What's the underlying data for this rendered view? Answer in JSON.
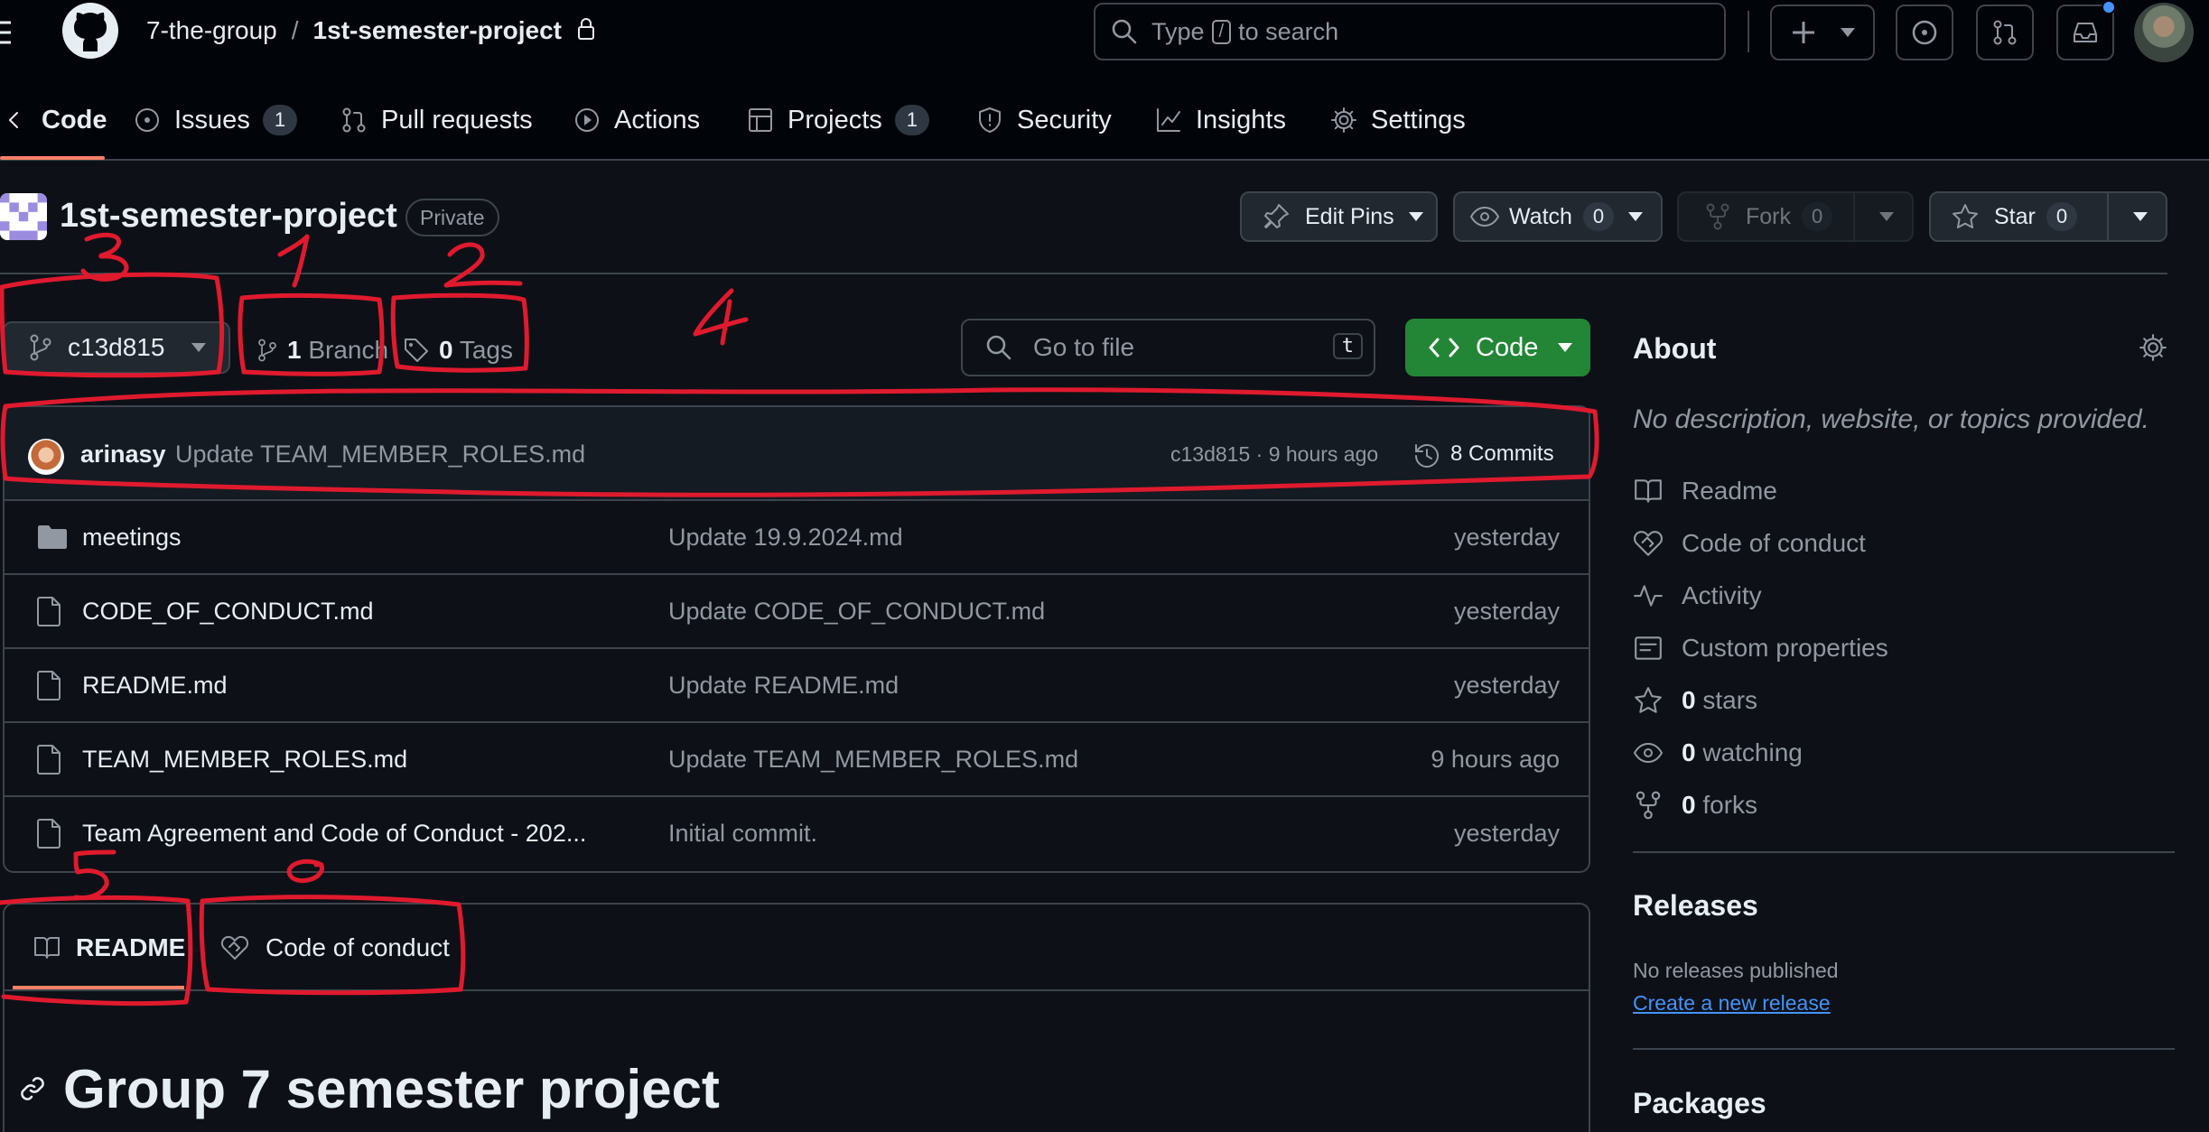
{
  "header": {
    "owner": "7-the-group",
    "separator": "/",
    "repo": "1st-semester-project",
    "search_placeholder": "Type / to search",
    "search_prefix": "Type",
    "search_key": "/",
    "search_suffix": "to search",
    "plus_label": "+"
  },
  "nav": {
    "tabs": [
      {
        "label": "Code",
        "icon": "code-icon"
      },
      {
        "label": "Issues",
        "icon": "issue-icon",
        "count": "1"
      },
      {
        "label": "Pull requests",
        "icon": "pull-request-icon"
      },
      {
        "label": "Actions",
        "icon": "play-icon"
      },
      {
        "label": "Projects",
        "icon": "table-icon",
        "count": "1"
      },
      {
        "label": "Security",
        "icon": "shield-icon"
      },
      {
        "label": "Insights",
        "icon": "graph-icon"
      },
      {
        "label": "Settings",
        "icon": "gear-icon"
      }
    ]
  },
  "repo": {
    "name": "1st-semester-project",
    "visibility": "Private",
    "edit_pins": "Edit Pins",
    "watch": "Watch",
    "watch_count": "0",
    "fork": "Fork",
    "fork_count": "0",
    "star": "Star",
    "star_count": "0"
  },
  "toolbar": {
    "branch": "c13d815",
    "branch_count": "1",
    "branch_label": "Branch",
    "tag_count": "0",
    "tag_label": "Tags",
    "goto_placeholder": "Go to file",
    "goto_key": "t",
    "code_button": "Code"
  },
  "commit": {
    "author": "arinasy",
    "message": "Update TEAM_MEMBER_ROLES.md",
    "sha_time": "c13d815 · 9 hours ago",
    "commits": "8 Commits"
  },
  "files": [
    {
      "type": "folder",
      "name": "meetings",
      "message": "Update 19.9.2024.md",
      "date": "yesterday"
    },
    {
      "type": "file",
      "name": "CODE_OF_CONDUCT.md",
      "message": "Update CODE_OF_CONDUCT.md",
      "date": "yesterday"
    },
    {
      "type": "file",
      "name": "README.md",
      "message": "Update README.md",
      "date": "yesterday"
    },
    {
      "type": "file",
      "name": "TEAM_MEMBER_ROLES.md",
      "message": "Update TEAM_MEMBER_ROLES.md",
      "date": "9 hours ago"
    },
    {
      "type": "file",
      "name": "Team Agreement and Code of Conduct - 202...",
      "message": "Initial commit.",
      "date": "yesterday"
    }
  ],
  "readme": {
    "tab_readme": "README",
    "tab_conduct": "Code of conduct",
    "heading": "Group 7 semester project"
  },
  "about": {
    "title": "About",
    "description": "No description, website, or topics provided.",
    "items": [
      {
        "icon": "book-icon",
        "label": "Readme"
      },
      {
        "icon": "heart-handshake-icon",
        "label": "Code of conduct"
      },
      {
        "icon": "pulse-icon",
        "label": "Activity"
      },
      {
        "icon": "note-icon",
        "label": "Custom properties"
      }
    ],
    "stars_count": "0",
    "stars_label": "stars",
    "watching_count": "0",
    "watching_label": "watching",
    "forks_count": "0",
    "forks_label": "forks"
  },
  "releases": {
    "title": "Releases",
    "none": "No releases published",
    "create_link": "Create a new release"
  },
  "packages": {
    "title": "Packages"
  },
  "annotations": [
    "1",
    "2",
    "3",
    "4",
    "5",
    "6"
  ],
  "colors": {
    "background": "#0d1117",
    "header": "#010409",
    "border": "#3d444d",
    "accent_green": "#238636",
    "link": "#4493f8",
    "annotation_red": "#e01a2e",
    "tab_underline": "#f78166"
  }
}
